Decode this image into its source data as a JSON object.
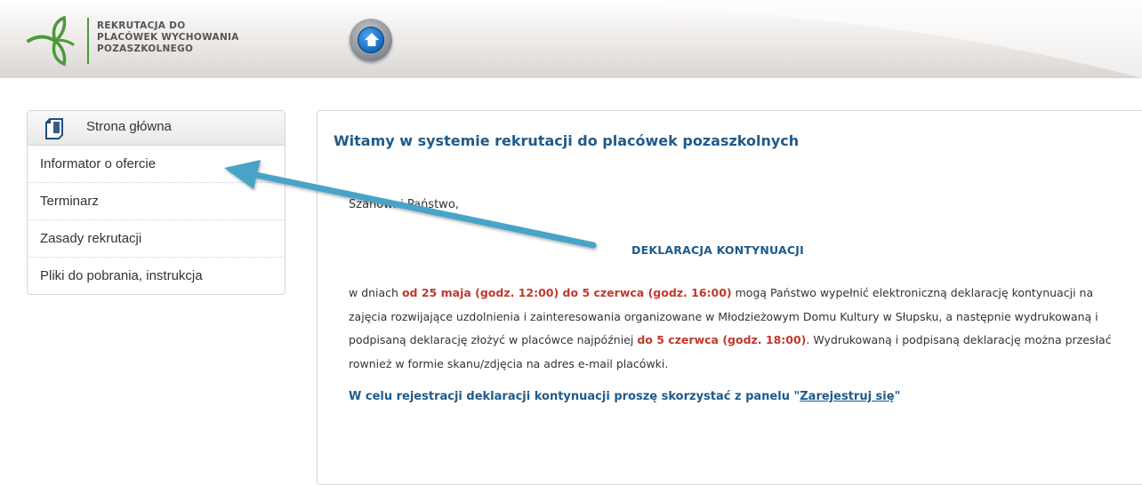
{
  "header": {
    "logo_lines": [
      "REKRUTACJA DO",
      "PLACÓWEK WYCHOWANIA",
      "POZASZKOLNEGO"
    ],
    "home_icon": "home-icon"
  },
  "sidebar": {
    "title": "Strona główna",
    "title_icon": "document-icon",
    "items": [
      {
        "label": "Informator o ofercie"
      },
      {
        "label": "Terminarz"
      },
      {
        "label": "Zasady rekrutacji"
      },
      {
        "label": "Pliki do pobrania, instrukcja"
      }
    ]
  },
  "main": {
    "title": "Witamy w systemie rekrutacji do placówek pozaszkolnych",
    "greeting": "Szanowni Państwo,",
    "decl_title": "DEKLARACJA KONTYNUACJI",
    "para": {
      "t1": "w dniach ",
      "r1": "od 25 maja (godz. 12:00) do 5 czerwca (godz. 16:00)",
      "t2": " mogą Państwo wypełnić elektroniczną deklarację kontynuacji na zajęcia rozwijające uzdolnienia i zainteresowania organizowane w Młodzieżowym Domu Kultury w Słupsku, a następnie wydrukowaną i podpisaną deklarację złożyć w placówce najpóźniej ",
      "r2": "do 5 czerwca (godz. 18:00)",
      "t3": ". Wydrukowaną i podpisaną deklarację można przesłać rownież w formie skanu/zdjęcia na adres e-mail placówki."
    },
    "cta": {
      "text": "W celu rejestracji deklaracji kontynuacji proszę skorzystać z panelu \"",
      "link": "Zarejestruj się",
      "end": "\""
    }
  },
  "colors": {
    "accent_blue": "#1f5a8a",
    "highlight_red": "#c0392b",
    "arrow": "#4aa3c8",
    "logo_green": "#4a9a3a"
  }
}
